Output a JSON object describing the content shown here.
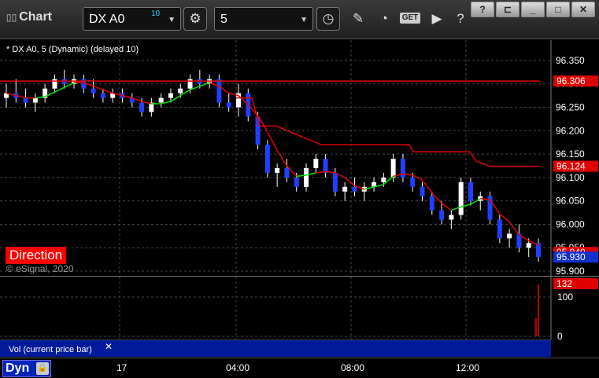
{
  "toolbar": {
    "app_title": "Chart",
    "symbol": "DX A0",
    "symbol_badge": "10",
    "interval": "5",
    "get_label": "GET"
  },
  "study": {
    "label": "* DX A0, 5 (Dynamic) (delayed 10)",
    "direction_label": "Direction",
    "copyright": "© eSignal, 2020"
  },
  "volume": {
    "label": "Vol (current price bar)",
    "close_glyph": "✕",
    "current": "132",
    "axis_ticks": [
      "100",
      "0"
    ]
  },
  "time_axis": {
    "dyn_label": "Dyn",
    "ticks": [
      "17",
      "04:00",
      "08:00",
      "12:00"
    ]
  },
  "price_axis": {
    "ticks": [
      "96.350",
      "96.300",
      "96.250",
      "96.200",
      "96.150",
      "96.100",
      "96.050",
      "96.000",
      "95.950",
      "95.900"
    ],
    "markers": [
      {
        "value": "96.306",
        "color": "#e00000"
      },
      {
        "value": "96.124",
        "color": "#e00000"
      },
      {
        "value": "95.940",
        "color": "#e00000"
      },
      {
        "value": "95.930",
        "color": "#1030d0"
      }
    ]
  },
  "chart_data": {
    "type": "candlestick",
    "ylim": [
      95.895,
      96.365
    ],
    "x_ticks": [
      "17",
      "04:00",
      "08:00",
      "12:00"
    ],
    "ohlc": [
      [
        96.27,
        96.3,
        96.25,
        96.28
      ],
      [
        96.28,
        96.31,
        96.26,
        96.27
      ],
      [
        96.27,
        96.29,
        96.25,
        96.26
      ],
      [
        96.26,
        96.28,
        96.24,
        96.27
      ],
      [
        96.27,
        96.3,
        96.26,
        96.29
      ],
      [
        96.29,
        96.32,
        96.28,
        96.31
      ],
      [
        96.31,
        96.33,
        96.29,
        96.3
      ],
      [
        96.3,
        96.32,
        96.29,
        96.31
      ],
      [
        96.31,
        96.32,
        96.28,
        96.29
      ],
      [
        96.29,
        96.31,
        96.27,
        96.28
      ],
      [
        96.28,
        96.29,
        96.26,
        96.27
      ],
      [
        96.27,
        96.29,
        96.26,
        96.28
      ],
      [
        96.28,
        96.29,
        96.26,
        96.27
      ],
      [
        96.27,
        96.28,
        96.25,
        96.26
      ],
      [
        96.26,
        96.27,
        96.23,
        96.24
      ],
      [
        96.24,
        96.27,
        96.23,
        96.26
      ],
      [
        96.26,
        96.28,
        96.25,
        96.27
      ],
      [
        96.27,
        96.29,
        96.26,
        96.28
      ],
      [
        96.28,
        96.3,
        96.27,
        96.29
      ],
      [
        96.29,
        96.32,
        96.28,
        96.31
      ],
      [
        96.31,
        96.33,
        96.29,
        96.3
      ],
      [
        96.3,
        96.32,
        96.29,
        96.31
      ],
      [
        96.31,
        96.32,
        96.25,
        96.26
      ],
      [
        96.26,
        96.28,
        96.24,
        96.25
      ],
      [
        96.25,
        96.3,
        96.23,
        96.28
      ],
      [
        96.28,
        96.29,
        96.22,
        96.23
      ],
      [
        96.23,
        96.24,
        96.16,
        96.17
      ],
      [
        96.17,
        96.18,
        96.1,
        96.11
      ],
      [
        96.11,
        96.13,
        96.08,
        96.12
      ],
      [
        96.12,
        96.14,
        96.09,
        96.1
      ],
      [
        96.1,
        96.11,
        96.07,
        96.08
      ],
      [
        96.08,
        96.13,
        96.07,
        96.12
      ],
      [
        96.12,
        96.15,
        96.11,
        96.14
      ],
      [
        96.14,
        96.15,
        96.1,
        96.11
      ],
      [
        96.11,
        96.12,
        96.06,
        96.07
      ],
      [
        96.07,
        96.09,
        96.05,
        96.08
      ],
      [
        96.08,
        96.1,
        96.06,
        96.07
      ],
      [
        96.07,
        96.09,
        96.05,
        96.08
      ],
      [
        96.08,
        96.1,
        96.07,
        96.09
      ],
      [
        96.09,
        96.11,
        96.08,
        96.1
      ],
      [
        96.1,
        96.15,
        96.09,
        96.14
      ],
      [
        96.14,
        96.15,
        96.09,
        96.1
      ],
      [
        96.1,
        96.11,
        96.07,
        96.08
      ],
      [
        96.08,
        96.09,
        96.05,
        96.06
      ],
      [
        96.06,
        96.07,
        96.02,
        96.03
      ],
      [
        96.03,
        96.05,
        96.0,
        96.01
      ],
      [
        96.01,
        96.03,
        95.99,
        96.02
      ],
      [
        96.02,
        96.1,
        96.01,
        96.09
      ],
      [
        96.09,
        96.1,
        96.04,
        96.05
      ],
      [
        96.05,
        96.07,
        96.03,
        96.06
      ],
      [
        96.06,
        96.07,
        96.0,
        96.01
      ],
      [
        96.01,
        96.02,
        95.96,
        95.97
      ],
      [
        95.97,
        95.99,
        95.95,
        95.98
      ],
      [
        95.98,
        96.0,
        95.94,
        95.95
      ],
      [
        95.95,
        95.97,
        95.93,
        95.96
      ],
      [
        95.96,
        95.97,
        95.92,
        95.93
      ]
    ],
    "series": [
      {
        "name": "",
        "color": "#e00000",
        "values": [
          96.306,
          96.306,
          96.306,
          96.306
        ]
      },
      {
        "name": "",
        "color": "#e00000",
        "values": [
          96.124,
          96.124
        ]
      }
    ],
    "volume": [
      132
    ]
  }
}
